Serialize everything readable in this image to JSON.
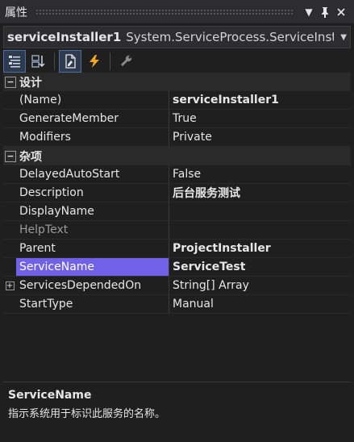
{
  "window": {
    "title": "属性"
  },
  "object_selector": {
    "name": "serviceInstaller1",
    "type": "System.ServiceProcess.ServiceInstalle"
  },
  "toolbar": {
    "buttons": [
      {
        "icon": "categorized-icon",
        "active": true
      },
      {
        "icon": "alphabetical-icon",
        "active": false
      },
      {
        "icon": "properties-page-icon",
        "active": true
      },
      {
        "icon": "events-icon",
        "active": false
      },
      {
        "icon": "wrench-icon",
        "active": false
      }
    ]
  },
  "grid": {
    "cat_design": {
      "label": "设计"
    },
    "cat_misc": {
      "label": "杂项"
    },
    "rows": [
      {
        "name": "(Name)",
        "value": "serviceInstaller1",
        "bold": true
      },
      {
        "name": "GenerateMember",
        "value": "True",
        "bold": false
      },
      {
        "name": "Modifiers",
        "value": "Private",
        "bold": false
      },
      {
        "name": "DelayedAutoStart",
        "value": "False",
        "bold": false
      },
      {
        "name": "Description",
        "value": "后台服务测试",
        "bold": true
      },
      {
        "name": "DisplayName",
        "value": "",
        "bold": false
      },
      {
        "name": "HelpText",
        "value": "",
        "bold": false
      },
      {
        "name": "Parent",
        "value": "ProjectInstaller",
        "bold": true
      },
      {
        "name": "ServiceName",
        "value": "ServiceTest",
        "bold": true
      },
      {
        "name": "ServicesDependedOn",
        "value": "String[] Array",
        "bold": false
      },
      {
        "name": "StartType",
        "value": "Manual",
        "bold": false
      }
    ]
  },
  "description": {
    "title": "ServiceName",
    "text": "指示系统用于标识此服务的名称。"
  },
  "colors": {
    "selection": "#7160e8",
    "background": "#1f1f1f",
    "category_bg": "#2a2a2a"
  }
}
